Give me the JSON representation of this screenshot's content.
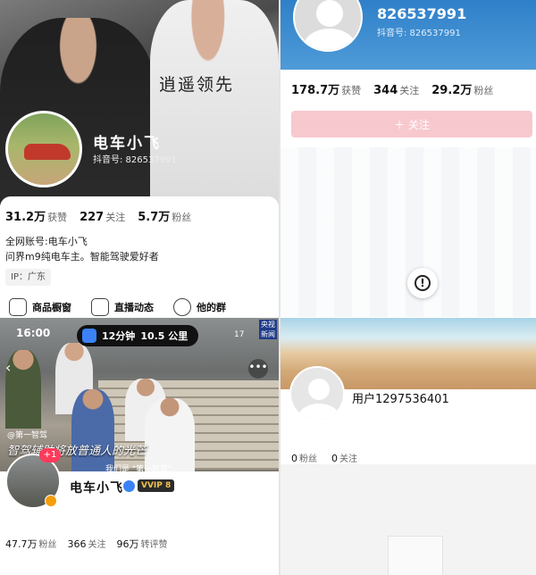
{
  "panel_a": {
    "shirt_text": "逍遥领先",
    "name": "电车小飞",
    "douyin_id": "抖音号: 826537991",
    "stats": [
      {
        "value": "31.2万",
        "label": "获赞"
      },
      {
        "value": "227",
        "label": "关注"
      },
      {
        "value": "5.7万",
        "label": "粉丝"
      }
    ],
    "bio_line1": "全网账号:电车小飞",
    "bio_line2": "问界m9纯电车主。智能驾驶爱好者",
    "ip": "IP：广东",
    "shortcuts": [
      {
        "label": "商品橱窗",
        "icon": "shopping-bag-icon"
      },
      {
        "label": "直播动态",
        "icon": "tv-icon"
      },
      {
        "label": "他的群",
        "icon": "chat-group-icon"
      }
    ]
  },
  "panel_b": {
    "id_big": "826537991",
    "id_small": "抖音号: 826537991",
    "stats": [
      {
        "value": "178.7万",
        "label": "获赞"
      },
      {
        "value": "344",
        "label": "关注"
      },
      {
        "value": "29.2万",
        "label": "粉丝"
      }
    ],
    "follow_label": "＋ 关注",
    "alert_glyph": "!"
  },
  "panel_c": {
    "time": "16:00",
    "nav_label": "12分钟",
    "nav_distance": "10.5 公里",
    "battery": "17",
    "cctv_badge": "央视新闻",
    "back_glyph": "‹",
    "more_glyph": "•••",
    "tag": "@第一智驾",
    "subtitle": "智驾辅助将放普通人的光芒",
    "caption": "我们是 \"第一智驾\"",
    "plus_badge": "+1",
    "name": "电车小飞",
    "vip_label": "VVIP 8",
    "stats": [
      {
        "value": "47.7万",
        "label": "粉丝"
      },
      {
        "value": "366",
        "label": "关注"
      },
      {
        "value": "96万",
        "label": "转评赞"
      }
    ]
  },
  "panel_d": {
    "username": "用户1297536401",
    "stats": [
      {
        "value": "0",
        "label": "粉丝"
      },
      {
        "value": "0",
        "label": "关注"
      }
    ]
  },
  "colors": {
    "follow_button": "#f7c9cf",
    "header_blue": "#2f80c9",
    "badge_red": "#ff3b5c",
    "verified_blue": "#3b82f6"
  }
}
